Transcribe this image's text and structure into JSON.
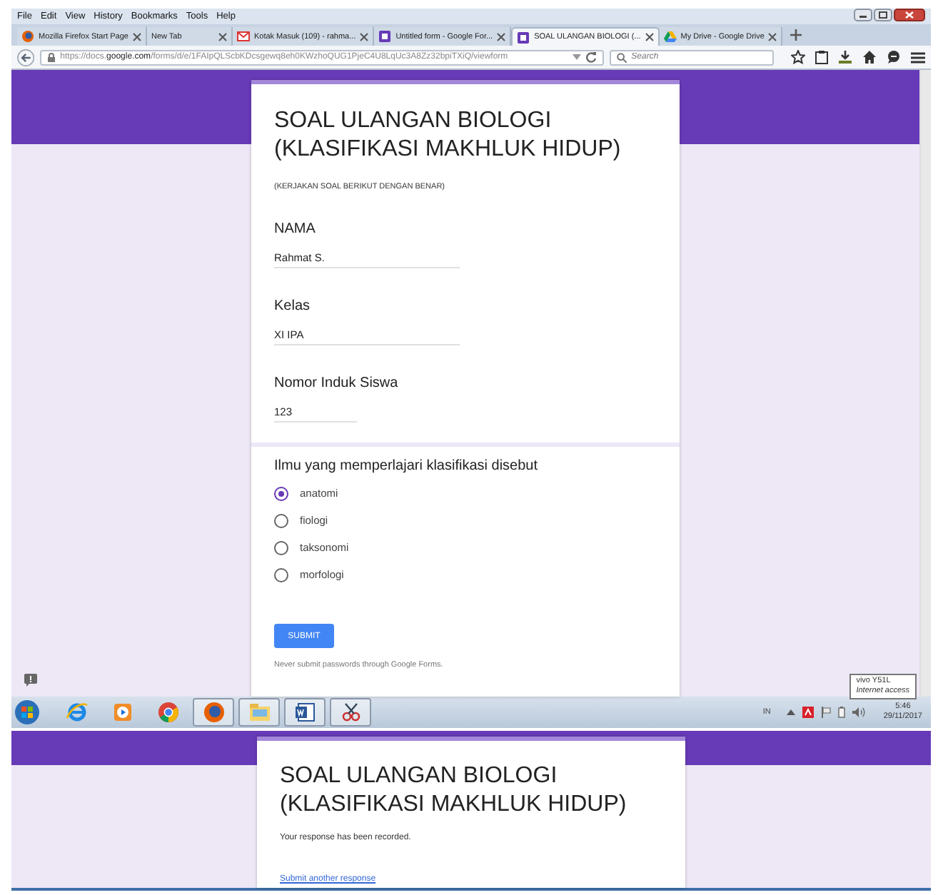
{
  "menu": [
    "File",
    "Edit",
    "View",
    "History",
    "Bookmarks",
    "Tools",
    "Help"
  ],
  "tabs": [
    {
      "label": "Mozilla Firefox Start Page",
      "kind": "firefox",
      "selected": false
    },
    {
      "label": "New Tab",
      "kind": "blank",
      "selected": false
    },
    {
      "label": "Kotak Masuk (109) - rahma...",
      "kind": "mail",
      "selected": false
    },
    {
      "label": "Untitled form - Google For...",
      "kind": "form",
      "selected": false
    },
    {
      "label": "SOAL ULANGAN BIOLOGI (...",
      "kind": "form",
      "selected": true
    },
    {
      "label": "My Drive - Google Drive",
      "kind": "drive",
      "selected": false
    }
  ],
  "address": {
    "url_prefix": "https://docs.",
    "url_domain": "google.com",
    "url_path": "/forms/d/e/1FAIpQLScbKDcsgewq8eh0KWzhoQUG1PjeC4U8LqUc3A8Zz32bpiTXiQ/viewform"
  },
  "search": {
    "placeholder": "Search"
  },
  "form": {
    "title": "SOAL ULANGAN BIOLOGI (KLASIFIKASI MAKHLUK HIDUP)",
    "description": "(KERJAKAN SOAL BERIKUT DENGAN BENAR)",
    "fields": [
      {
        "label": "NAMA",
        "value": "Rahmat S."
      },
      {
        "label": "Kelas",
        "value": "XI IPA"
      },
      {
        "label": "Nomor Induk Siswa",
        "value": "123"
      }
    ],
    "question": {
      "text": "Ilmu yang memperlajari klasifikasi disebut",
      "options": [
        {
          "label": "anatomi",
          "selected": true
        },
        {
          "label": "fiologi",
          "selected": false
        },
        {
          "label": "taksonomi",
          "selected": false
        },
        {
          "label": "morfologi",
          "selected": false
        }
      ]
    },
    "submit": "SUBMIT",
    "footer": "Never submit passwords through Google Forms."
  },
  "taskbar": [
    {
      "kind": "ie",
      "running": false
    },
    {
      "kind": "media",
      "running": false
    },
    {
      "kind": "chrome",
      "running": false
    },
    {
      "kind": "firefox",
      "running": true
    },
    {
      "kind": "explorer",
      "running": true
    },
    {
      "kind": "word",
      "running": true
    },
    {
      "kind": "snip",
      "running": true
    }
  ],
  "tray": {
    "language": "IN",
    "time": "5:46",
    "date": "29/11/2017"
  },
  "tooltip": {
    "title": "vivo Y51L",
    "text": "Internet access"
  },
  "response": {
    "title": "SOAL ULANGAN BIOLOGI (KLASIFIKASI MAKHLUK HIDUP)",
    "message": "Your response has been recorded.",
    "link": "Submit another response"
  }
}
